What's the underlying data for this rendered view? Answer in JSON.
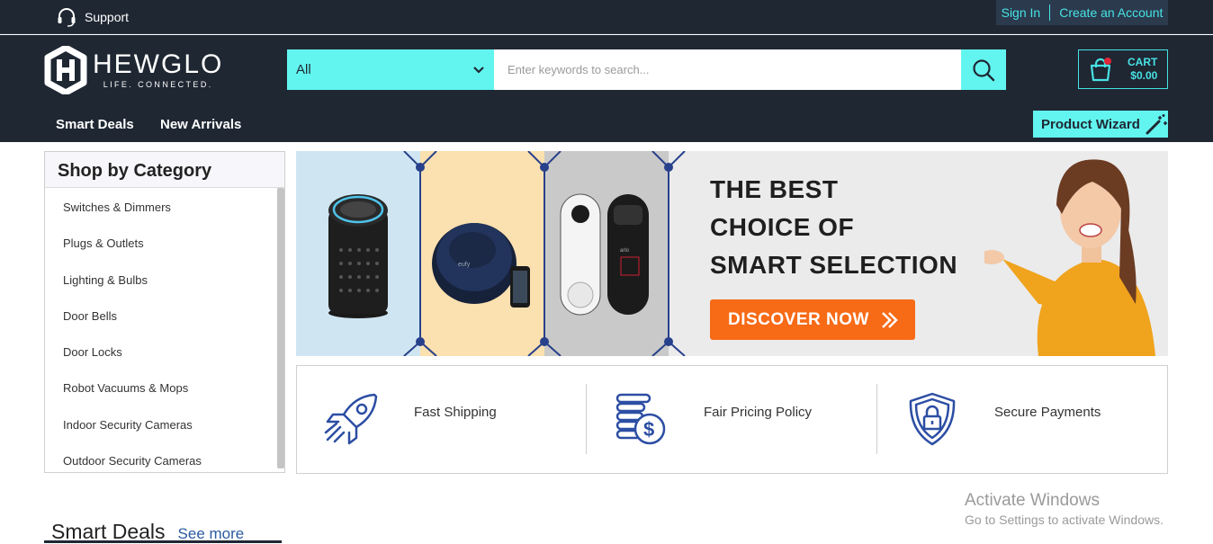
{
  "topbar": {
    "support_label": "Support",
    "sign_in": "Sign In",
    "create_account": "Create an Account"
  },
  "brand": {
    "name": "HEWGLO",
    "tagline": "LIFE. CONNECTED."
  },
  "search": {
    "category_value": "All",
    "placeholder": "Enter keywords to search..."
  },
  "cart": {
    "label": "CART",
    "total": "$0.00"
  },
  "nav": {
    "items": [
      {
        "label": "Smart Deals"
      },
      {
        "label": "New Arrivals"
      }
    ],
    "wizard_label": "Product Wizard"
  },
  "categories": {
    "title": "Shop by Category",
    "items": [
      {
        "label": "Switches & Dimmers"
      },
      {
        "label": "Plugs & Outlets"
      },
      {
        "label": "Lighting & Bulbs"
      },
      {
        "label": "Door Bells"
      },
      {
        "label": "Door Locks"
      },
      {
        "label": "Robot Vacuums & Mops"
      },
      {
        "label": "Indoor Security Cameras"
      },
      {
        "label": "Outdoor Security Cameras"
      }
    ]
  },
  "banner": {
    "line1": "THE BEST",
    "line2": "CHOICE OF",
    "line3": "SMART SELECTION",
    "cta": "DISCOVER NOW",
    "product_labels": {
      "vacuum": "eufy",
      "doorbell": "arlo"
    },
    "colors": {
      "panel1": "#cfe6f2",
      "panel2": "#fbe0b0",
      "panel3": "#c9c9c9",
      "cta": "#f76a16"
    }
  },
  "features": [
    {
      "label": "Fast Shipping",
      "icon": "rocket-icon"
    },
    {
      "label": "Fair Pricing Policy",
      "icon": "coins-dollar-icon"
    },
    {
      "label": "Secure Payments",
      "icon": "shield-lock-icon"
    }
  ],
  "watermark": {
    "title": "Activate Windows",
    "subtitle": "Go to Settings to activate Windows."
  },
  "section": {
    "title": "Smart Deals",
    "see_more": "See more"
  },
  "colors": {
    "dark": "#1f2733",
    "accent": "#62f5ef",
    "link": "#47e3e5",
    "icon_blue": "#2c4ea3"
  }
}
